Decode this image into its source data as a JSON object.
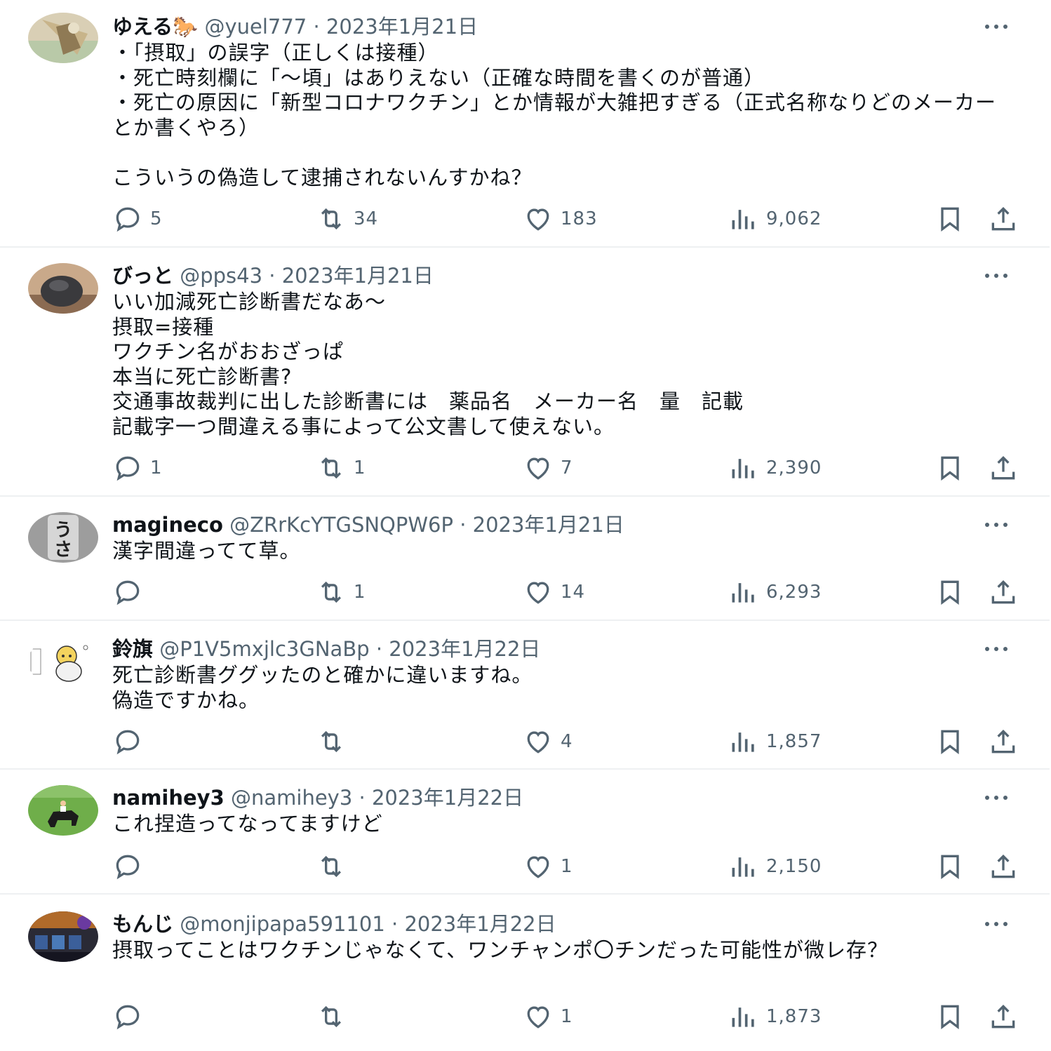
{
  "colors": {
    "text": "#0f1419",
    "secondary": "#536471",
    "divider": "#eef0f2"
  },
  "icons": [
    "reply-icon",
    "retweet-icon",
    "like-icon",
    "views-icon",
    "bookmark-icon",
    "share-icon",
    "more-icon"
  ],
  "tweets": [
    {
      "name": "ゆえる🐎",
      "handle": "@yuel777",
      "sep": "·",
      "date": "2023年1月21日",
      "text": "・「摂取」の誤字（正しくは接種）\n・死亡時刻欄に「〜頃」はありえない（正確な時間を書くのが普通）\n・死亡の原因に「新型コロナワクチン」とか情報が大雑把すぎる（正式名称なりどのメーカーとか書くやろ）\n\nこういうの偽造して逮捕されないんすかね？",
      "replies": "5",
      "retweets": "34",
      "likes": "183",
      "views": "9,062"
    },
    {
      "name": "びっと",
      "handle": "@pps43",
      "sep": "·",
      "date": "2023年1月21日",
      "text": "いい加減死亡診断書だなあ〜\n摂取=接種\nワクチン名がおおざっぱ\n本当に死亡診断書?\n交通事故裁判に出した診断書には　薬品名　メーカー名　量　記載\n記載字一つ間違える事によって公文書して使えない。",
      "replies": "1",
      "retweets": "1",
      "likes": "7",
      "views": "2,390"
    },
    {
      "name": "magineco",
      "handle": "@ZRrKcYTGSNQPW6P",
      "sep": "·",
      "date": "2023年1月21日",
      "text": "漢字間違ってて草。",
      "replies": "",
      "retweets": "1",
      "likes": "14",
      "views": "6,293"
    },
    {
      "name": "鈴旗",
      "handle": "@P1V5mxjlc3GNaBp",
      "sep": "·",
      "date": "2023年1月22日",
      "text": "死亡診断書ググッたのと確かに違いますね。\n偽造ですかね。",
      "replies": "",
      "retweets": "",
      "likes": "4",
      "views": "1,857"
    },
    {
      "name": "namihey3",
      "handle": "@namihey3",
      "sep": "·",
      "date": "2023年1月22日",
      "text": "これ捏造ってなってますけど",
      "replies": "",
      "retweets": "",
      "likes": "1",
      "views": "2,150"
    },
    {
      "name": "もんじ",
      "handle": "@monjipapa591101",
      "sep": "·",
      "date": "2023年1月22日",
      "text": "摂取ってことはワクチンじゃなくて、ワンチャンポ〇チンだった可能性が微レ存？",
      "replies": "",
      "retweets": "",
      "likes": "1",
      "views": "1,873"
    }
  ]
}
